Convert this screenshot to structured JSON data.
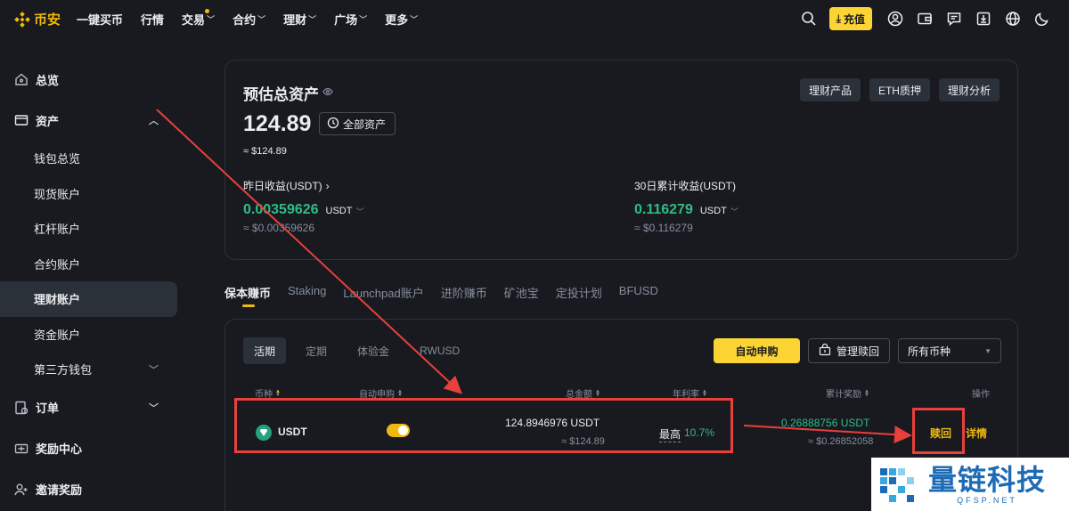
{
  "brand": {
    "name": "币安",
    "accent": "#f0b90b"
  },
  "nav": {
    "items": [
      {
        "label": "一键买币",
        "has_chevron": false
      },
      {
        "label": "行情",
        "has_chevron": false
      },
      {
        "label": "交易",
        "has_chevron": true,
        "dot": true
      },
      {
        "label": "合约",
        "has_chevron": true
      },
      {
        "label": "理财",
        "has_chevron": true
      },
      {
        "label": "广场",
        "has_chevron": true
      },
      {
        "label": "更多",
        "has_chevron": true
      }
    ],
    "deposit_label": "充值",
    "right_icons": [
      "search-icon",
      "user-icon",
      "wallet-icon",
      "message-icon",
      "download-icon",
      "globe-icon",
      "moon-icon"
    ]
  },
  "sidebar": {
    "items": [
      {
        "label": "总览",
        "type": "top",
        "icon": "home-icon"
      },
      {
        "label": "资产",
        "type": "top",
        "icon": "wallet-icon",
        "chevron": "up"
      },
      {
        "label": "钱包总览",
        "type": "sub"
      },
      {
        "label": "现货账户",
        "type": "sub"
      },
      {
        "label": "杠杆账户",
        "type": "sub"
      },
      {
        "label": "合约账户",
        "type": "sub"
      },
      {
        "label": "理财账户",
        "type": "sub",
        "active": true
      },
      {
        "label": "资金账户",
        "type": "sub"
      },
      {
        "label": "第三方钱包",
        "type": "sub",
        "chevron": "down"
      },
      {
        "label": "订单",
        "type": "top",
        "icon": "order-icon",
        "chevron": "down"
      },
      {
        "label": "奖励中心",
        "type": "top",
        "icon": "reward-icon"
      },
      {
        "label": "邀请奖励",
        "type": "top",
        "icon": "invite-icon"
      }
    ]
  },
  "asset_card": {
    "title": "预估总资产",
    "value": "124.89",
    "all_assets_label": "全部资产",
    "usd_value": "≈ $124.89",
    "buttons": [
      "理财产品",
      "ETH质押",
      "理财分析"
    ],
    "yesterday": {
      "label": "昨日收益(USDT)",
      "value": "0.00359626",
      "unit": "USDT",
      "usd": "≈ $0.00359626"
    },
    "thirty_day": {
      "label": "30日累计收益(USDT)",
      "value": "0.116279",
      "unit": "USDT",
      "usd": "≈ $0.116279"
    }
  },
  "tabs": [
    "保本赚币",
    "Staking",
    "Launchpad账户",
    "进阶赚币",
    "矿池宝",
    "定投计划",
    "BFUSD"
  ],
  "product_card": {
    "subtabs": [
      "活期",
      "定期",
      "体验金",
      "RWUSD"
    ],
    "auto_subscribe_label": "自动申购",
    "manage_redeem_label": "管理赎回",
    "coin_select_label": "所有币种",
    "headers": {
      "coin": "币种",
      "auto_subscribe": "自动申购",
      "total": "总金额",
      "apr": "年利率",
      "rewards": "累计奖励",
      "action": "操作"
    },
    "row": {
      "coin": "USDT",
      "auto_subscribe_on": true,
      "total": "124.8946976 USDT",
      "total_usd": "≈ $124.89",
      "apr_prefix": "最高",
      "apr_value": "10.7%",
      "rewards": "0.26888756 USDT",
      "rewards_usd": "≈ $0.26852058",
      "redeem_label": "赎回",
      "detail_label": "详情"
    }
  },
  "watermark": {
    "cn": "量链科技",
    "en": "QFSP.NET"
  },
  "colors": {
    "background": "#181a20",
    "panel_border": "#2b3139",
    "green": "#2ebd85",
    "yellow": "#fcd535",
    "annotation_red": "#e8403b"
  }
}
